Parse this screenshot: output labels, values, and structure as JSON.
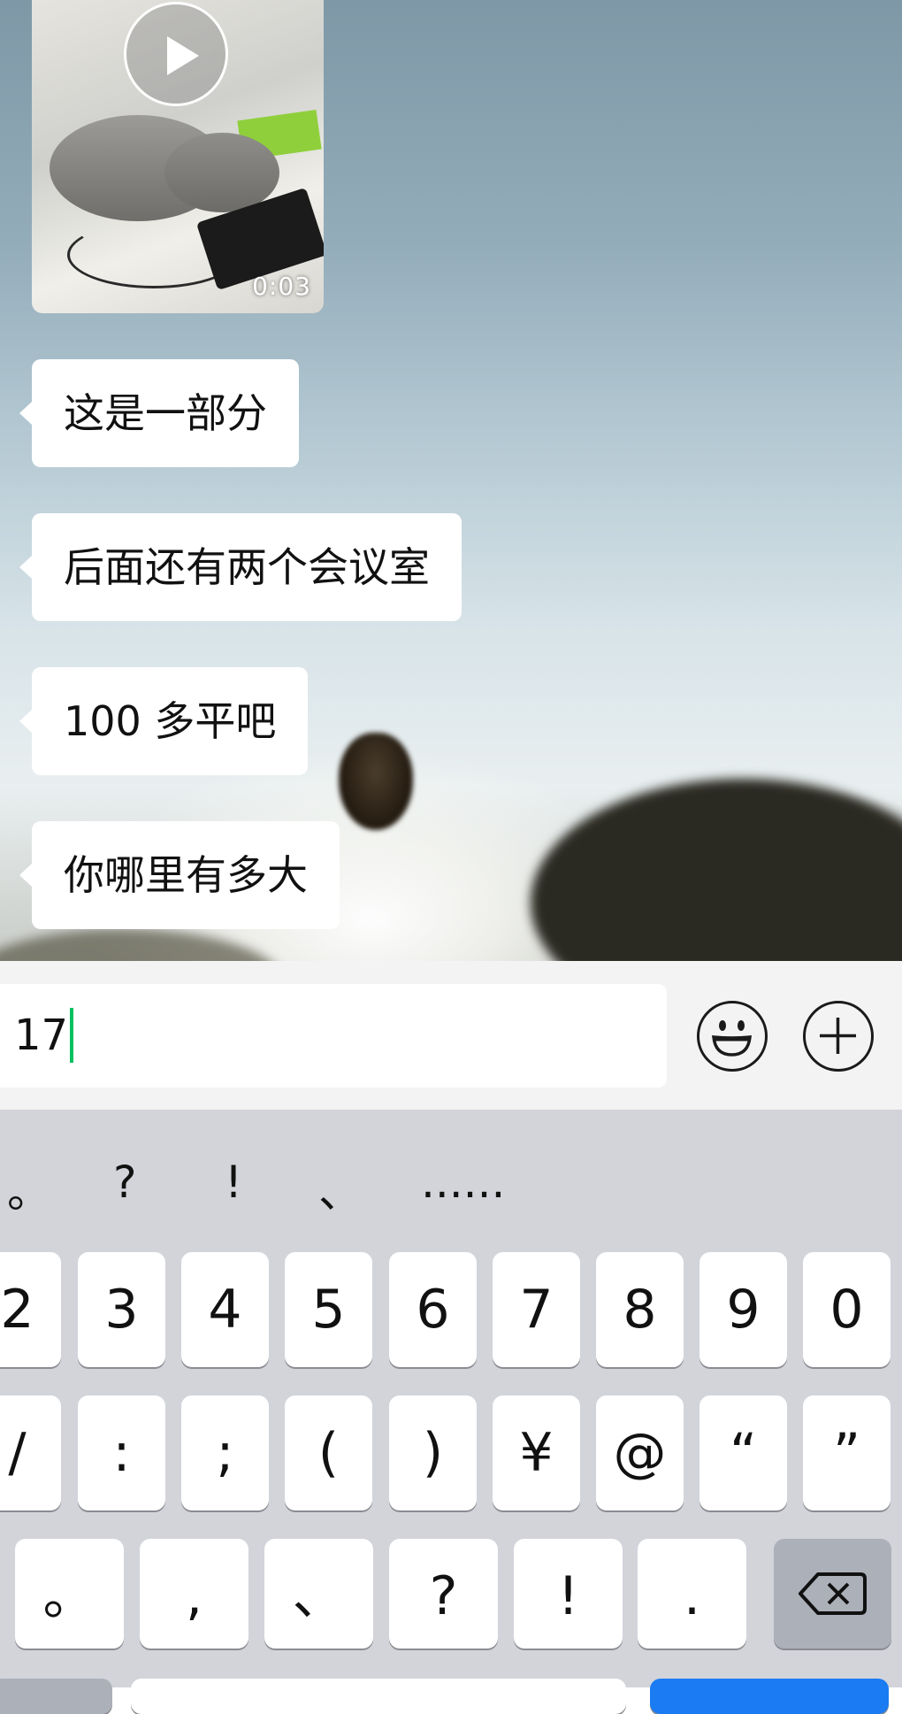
{
  "chat": {
    "video": {
      "duration": "0:03"
    },
    "messages": [
      {
        "text": "这是一部分"
      },
      {
        "text": "后面还有两个会议室"
      },
      {
        "text": "100 多平吧"
      },
      {
        "text": "你哪里有多大"
      }
    ]
  },
  "input": {
    "value": "17"
  },
  "keyboard": {
    "candidates": [
      "。",
      "?",
      "!",
      "、",
      "......"
    ],
    "row1": [
      "2",
      "3",
      "4",
      "5",
      "6",
      "7",
      "8",
      "9",
      "0"
    ],
    "row2": [
      "/",
      ":",
      ";",
      "(",
      ")",
      "¥",
      "@",
      "“",
      "”"
    ],
    "row3": [
      "。",
      ",",
      "、",
      "?",
      "!",
      "."
    ]
  },
  "icons": {
    "play": "play-icon",
    "emoji": "emoji-icon",
    "plus": "plus-icon",
    "backspace": "backspace-icon"
  },
  "colors": {
    "caret": "#07c160",
    "keyboard_bg": "#d2d4da",
    "key_bg": "#ffffff",
    "special_key_bg": "#acb0b9",
    "bubble_bg": "#ffffff"
  }
}
